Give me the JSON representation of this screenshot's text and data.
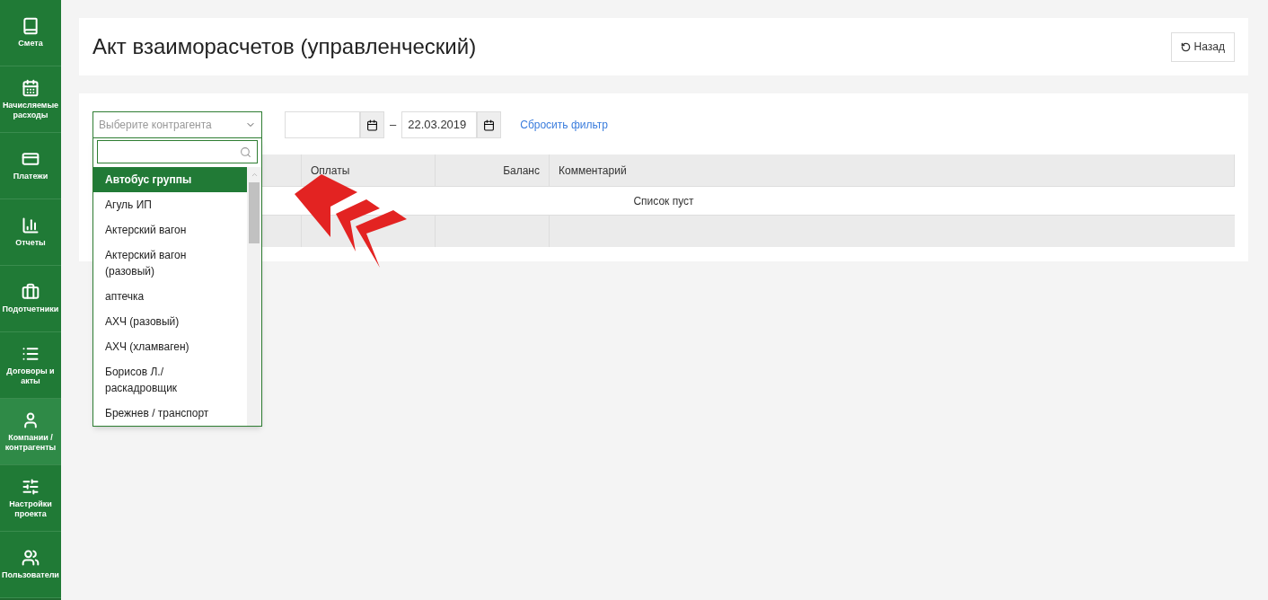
{
  "sidebar": {
    "items": [
      {
        "label": "Смета",
        "selected": false
      },
      {
        "label": "Начисляемые расходы",
        "selected": false
      },
      {
        "label": "Платежи",
        "selected": false
      },
      {
        "label": "Отчеты",
        "selected": false
      },
      {
        "label": "Подотчетники",
        "selected": false
      },
      {
        "label": "Договоры и акты",
        "selected": false
      },
      {
        "label": "Компании / контрагенты",
        "selected": true
      },
      {
        "label": "Настройки проекта",
        "selected": false
      },
      {
        "label": "Пользователи",
        "selected": false
      }
    ]
  },
  "page": {
    "title": "Акт взаиморасчетов (управленческий)",
    "back_button": "Назад"
  },
  "filter": {
    "counterparty": {
      "placeholder": "Выберите контрагента",
      "expanded": true
    },
    "date_separator": "–",
    "date_to": {
      "value": "22.03.2019"
    },
    "reset_link": "Сбросить фильтр"
  },
  "table": {
    "columns": [
      "Оплаты",
      "Баланс",
      "Комментарий"
    ],
    "empty_message": "Список пуст"
  },
  "dropdown": {
    "options": [
      {
        "label": "Автобус группы",
        "selected": true
      },
      {
        "label": "Агуль ИП",
        "selected": false
      },
      {
        "label": "Актерский вагон",
        "selected": false
      },
      {
        "label": "Актерский вагон (разовый)",
        "selected": false
      },
      {
        "label": "аптечка",
        "selected": false
      },
      {
        "label": "АХЧ (разовый)",
        "selected": false
      },
      {
        "label": "АХЧ (хламваген)",
        "selected": false
      },
      {
        "label": "Борисов Л./ раскадровщик",
        "selected": false
      },
      {
        "label": "Брежнев / транспорт",
        "selected": false
      }
    ]
  }
}
